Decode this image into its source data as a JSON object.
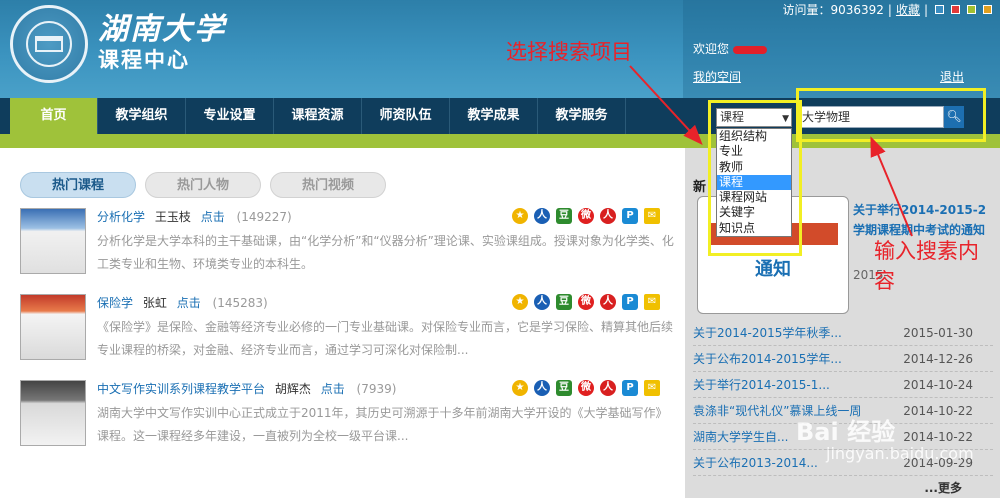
{
  "header": {
    "logo_title": "湖南大学",
    "logo_subtitle": "课程中心",
    "visit_label": "访问量：9036392",
    "favorite_label": "收藏",
    "welcome_label": "欢迎您",
    "myspace_label": "我的空间",
    "logout_label": "退出",
    "theme_colors": [
      "#3a8cc0",
      "#e23a3a",
      "#a0c030",
      "#e0a020"
    ]
  },
  "nav": {
    "items": [
      {
        "label": "首页",
        "active": true
      },
      {
        "label": "教学组织"
      },
      {
        "label": "专业设置"
      },
      {
        "label": "课程资源"
      },
      {
        "label": "师资队伍"
      },
      {
        "label": "教学成果"
      },
      {
        "label": "教学服务"
      }
    ]
  },
  "search": {
    "selected": "课程",
    "value": "大学物理",
    "button_icon": "search-icon",
    "options": [
      "组织结构",
      "专业",
      "教师",
      "课程",
      "课程网站",
      "关键字",
      "知识点"
    ],
    "highlighted_option": "课程"
  },
  "tabs": [
    {
      "label": "热门课程",
      "active": true
    },
    {
      "label": "热门人物"
    },
    {
      "label": "热门视频"
    }
  ],
  "courses": [
    {
      "name": "分析化学",
      "teacher": "王玉枝",
      "click_label": "点击",
      "count": "(149227)",
      "desc": "分析化学是大学本科的主干基础课，由“化学分析”和“仪器分析”理论课、实验课组成。授课对象为化学类、化工类专业和生物、环境类专业的本科生。"
    },
    {
      "name": "保险学",
      "teacher": "张虹",
      "click_label": "点击",
      "count": "(145283)",
      "desc": "《保险学》是保险、金融等经济专业必修的一门专业基础课。对保险专业而言，它是学习保险、精算其他后续专业课程的桥梁，对金融、经济专业而言，通过学习可深化对保险制..."
    },
    {
      "name": "中文写作实训系列课程教学平台",
      "teacher": "胡辉杰",
      "click_label": "点击",
      "count": "(7939)",
      "desc": "湖南大学中文写作实训中心正式成立于2011年，其历史可溯源于十多年前湖南大学开设的《大学基础写作》课程。这一课程经多年建设，一直被列为全校一级平台课..."
    }
  ],
  "share_icons": [
    "star-icon",
    "person-icon",
    "douban-icon",
    "weibo-icon",
    "renren-icon",
    "qzone-icon",
    "mail-icon"
  ],
  "news": {
    "heading": "新",
    "image_text": "通知",
    "featured_title": "关于举行2014-2015-2学期课程期中考试的通知",
    "featured_date": "2015-",
    "rows": [
      {
        "title": "关于2014-2015学年秋季...",
        "date": "2015-01-30"
      },
      {
        "title": "关于公布2014-2015学年...",
        "date": "2014-12-26"
      },
      {
        "title": "关于举行2014-2015-1...",
        "date": "2014-10-24"
      },
      {
        "title": "袁涤非“现代礼仪”慕课上线一周",
        "date": "2014-10-22"
      },
      {
        "title": "湖南大学学生自...",
        "date": "2014-10-22"
      },
      {
        "title": "关于公布2013-2014...",
        "date": "2014-09-29"
      }
    ],
    "more_label": "...更多"
  },
  "annotations": {
    "select_label": "选择搜索项目",
    "input_label": "输入搜素内容"
  },
  "watermark": {
    "text": "Bai 经验",
    "url": "jingyan.baidu.com"
  }
}
